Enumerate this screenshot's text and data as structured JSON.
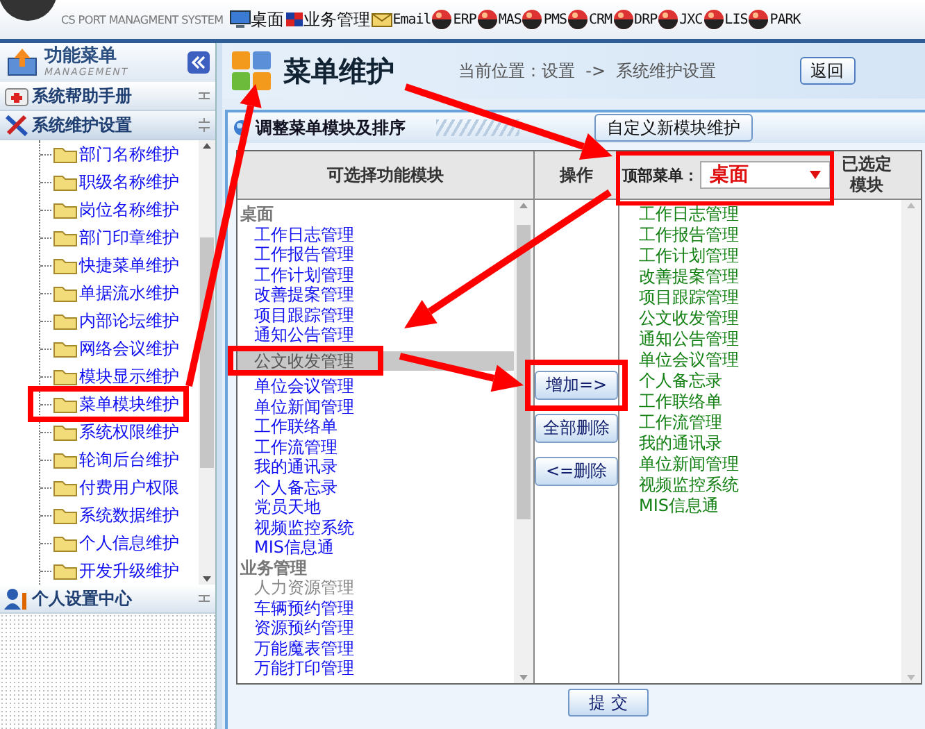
{
  "top_bar": {
    "system_name": "CS PORT MANAGMENT SYSTEM",
    "nav": [
      {
        "label": "桌面",
        "kind": "desktop"
      },
      {
        "label": "业务管理",
        "kind": "business"
      },
      {
        "label": "Email",
        "kind": "email"
      },
      {
        "label": "ERP",
        "kind": "module"
      },
      {
        "label": "MAS",
        "kind": "module"
      },
      {
        "label": "PMS",
        "kind": "module"
      },
      {
        "label": "CRM",
        "kind": "module"
      },
      {
        "label": "DRP",
        "kind": "module"
      },
      {
        "label": "JXC",
        "kind": "module"
      },
      {
        "label": "LIS",
        "kind": "module"
      },
      {
        "label": "PARK",
        "kind": "module"
      }
    ]
  },
  "sidebar": {
    "title": "功能菜单",
    "subtitle": "MANAGEMENT",
    "sections": [
      {
        "label": "系统帮助手册",
        "kind": "help",
        "expanded": false
      },
      {
        "label": "系统维护设置",
        "kind": "tools",
        "expanded": true,
        "children": [
          {
            "label": "部门名称维护"
          },
          {
            "label": "职级名称维护"
          },
          {
            "label": "岗位名称维护"
          },
          {
            "label": "部门印章维护"
          },
          {
            "label": "快捷菜单维护"
          },
          {
            "label": "单据流水维护"
          },
          {
            "label": "内部论坛维护"
          },
          {
            "label": "网络会议维护"
          },
          {
            "label": "模块显示维护"
          },
          {
            "label": "菜单模块维护"
          },
          {
            "label": "系统权限维护"
          },
          {
            "label": "轮询后台维护"
          },
          {
            "label": "付费用户权限"
          },
          {
            "label": "系统数据维护"
          },
          {
            "label": "个人信息维护"
          },
          {
            "label": "开发升级维护"
          }
        ]
      },
      {
        "label": "个人设置中心",
        "kind": "user",
        "expanded": false
      }
    ]
  },
  "page": {
    "title": "菜单维护",
    "breadcrumb": "当前位置：设置  ->  系统维护设置",
    "back_button": "返回"
  },
  "panel": {
    "title": "调整菜单模块及排序",
    "custom_button": "自定义新模块维护",
    "available": {
      "heading": "可选择功能模块",
      "groups": [
        {
          "label": "桌面",
          "items": [
            {
              "label": "工作日志管理",
              "selected": false,
              "disabled": false
            },
            {
              "label": "工作报告管理",
              "selected": false,
              "disabled": false
            },
            {
              "label": "工作计划管理",
              "selected": false,
              "disabled": false
            },
            {
              "label": "改善提案管理",
              "selected": false,
              "disabled": false
            },
            {
              "label": "项目跟踪管理",
              "selected": false,
              "disabled": false
            },
            {
              "label": "通知公告管理",
              "selected": false,
              "disabled": false
            },
            {
              "label": "公文收发管理",
              "selected": true,
              "disabled": false
            },
            {
              "label": "单位会议管理",
              "selected": false,
              "disabled": false
            },
            {
              "label": "单位新闻管理",
              "selected": false,
              "disabled": false
            },
            {
              "label": "工作联络单",
              "selected": false,
              "disabled": false
            },
            {
              "label": "工作流管理",
              "selected": false,
              "disabled": false
            },
            {
              "label": "我的通讯录",
              "selected": false,
              "disabled": false
            },
            {
              "label": "个人备忘录",
              "selected": false,
              "disabled": false
            },
            {
              "label": "党员天地",
              "selected": false,
              "disabled": false
            },
            {
              "label": "视频监控系统",
              "selected": false,
              "disabled": false
            },
            {
              "label": "MIS信息通",
              "selected": false,
              "disabled": false
            }
          ]
        },
        {
          "label": "业务管理",
          "items": [
            {
              "label": "人力资源管理",
              "selected": false,
              "disabled": true
            },
            {
              "label": "车辆预约管理",
              "selected": false,
              "disabled": false
            },
            {
              "label": "资源预约管理",
              "selected": false,
              "disabled": false
            },
            {
              "label": "万能魔表管理",
              "selected": false,
              "disabled": false
            },
            {
              "label": "万能打印管理",
              "selected": false,
              "disabled": false
            }
          ]
        }
      ]
    },
    "actions": {
      "heading": "操作",
      "buttons": [
        "增加=>",
        "全部删除",
        "<=删除"
      ]
    },
    "selected": {
      "top_menu_label": "顶部菜单：",
      "top_menu_value": "桌面",
      "heading": "已选定模块",
      "items": [
        "工作日志管理",
        "工作报告管理",
        "工作计划管理",
        "改善提案管理",
        "项目跟踪管理",
        "公文收发管理",
        "通知公告管理",
        "单位会议管理",
        "个人备忘录",
        "工作联络单",
        "工作流管理",
        "我的通讯录",
        "单位新闻管理",
        "视频监控系统",
        "MIS信息通"
      ]
    },
    "submit": "提 交"
  }
}
